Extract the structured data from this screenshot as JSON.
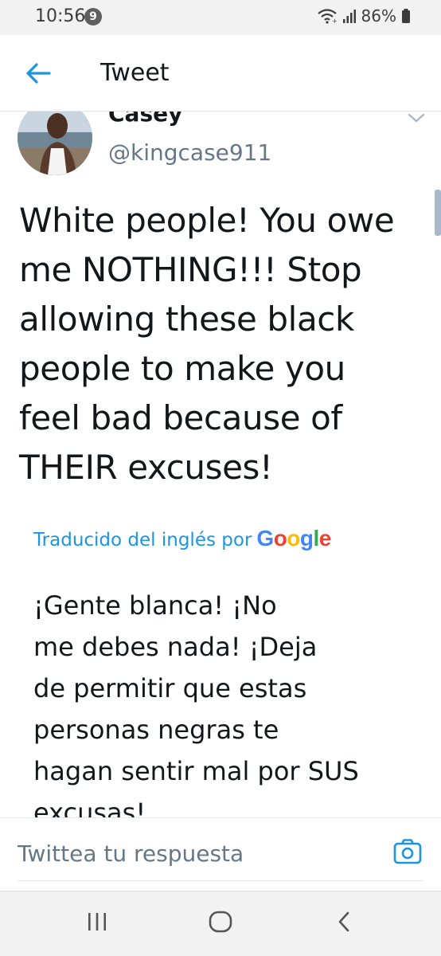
{
  "status_bar": {
    "time": "10:56",
    "notification_count": "9",
    "battery": "86%"
  },
  "header": {
    "title": "Tweet"
  },
  "tweet": {
    "author_name": "Casey",
    "author_handle": "@kingcase911",
    "text_lines": [
      "White people! You owe",
      "me NOTHING!!! Stop",
      "allowing these black",
      "people to make you",
      "feel bad because of",
      "THEIR excuses!"
    ],
    "translation_label": "Traducido del inglés por",
    "translation_provider": "Google",
    "translation_lines": [
      "¡Gente blanca! ¡No",
      "me debes nada! ¡Deja",
      "de permitir que estas",
      "personas negras te",
      "hagan sentir mal por SUS",
      "excusas!"
    ]
  },
  "reply": {
    "placeholder": "Twittea tu respuesta"
  },
  "colors": {
    "accent": "#1b95e0",
    "secondary_text": "#657786"
  }
}
